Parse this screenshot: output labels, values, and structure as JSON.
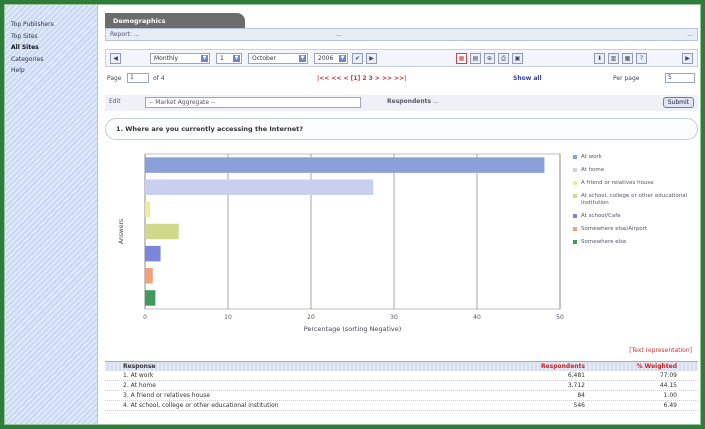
{
  "sidebar": {
    "items": [
      {
        "label": "Top Publishers"
      },
      {
        "label": "Top Sites"
      },
      {
        "label": "All Sites",
        "active": true
      },
      {
        "label": "Categories"
      },
      {
        "label": "Help"
      }
    ]
  },
  "tab": {
    "label": "Demographics"
  },
  "infobar": {
    "left": "Report: ...",
    "middle": "...",
    "right": "..."
  },
  "toolbar": {
    "period": "Monthly",
    "day": "1",
    "month": "October",
    "year": "2006"
  },
  "pager": {
    "page_label": "Page",
    "page_value": "1",
    "of_label": "of 4",
    "nav": "|<< << < [1] 2 3 > >> >>|",
    "show_all": "Show all",
    "per_page_label": "Per page",
    "per_page_value": "5"
  },
  "filter": {
    "label": "Edit",
    "select_value": "-- Market Aggregate --",
    "respondents_label": "Respondents",
    "respondents_value": "...",
    "button": "Submit"
  },
  "question": {
    "text": "1. Where are you currently accessing the Internet?"
  },
  "chart_data": {
    "type": "bar",
    "orientation": "horizontal",
    "title": "",
    "xlabel": "Percentage (sorting Negative)",
    "ylabel": "Answers",
    "xlim": [
      0,
      80
    ],
    "x_ticks": [
      "0",
      "10",
      "20",
      "30",
      "40",
      "50"
    ],
    "series": [
      {
        "name": "At work",
        "value": 77.0,
        "color": "#8aa0d8"
      },
      {
        "name": "At home",
        "value": 44.0,
        "color": "#c9cfee"
      },
      {
        "name": "A friend or relatives house",
        "value": 1.0,
        "color": "#e9ef9c"
      },
      {
        "name": "At school, college or other educational institution",
        "value": 6.5,
        "color": "#cfd98a"
      },
      {
        "name": "At school/Cafe",
        "value": 3.0,
        "color": "#7a86d6"
      },
      {
        "name": "Somewhere else/Airport",
        "value": 1.5,
        "color": "#f2a07c"
      },
      {
        "name": "Somewhere else",
        "value": 2.0,
        "color": "#3f9a5e"
      }
    ],
    "grid": true,
    "legend": "right"
  },
  "table_note": "[Text representation]",
  "table": {
    "headers": {
      "response": "Response",
      "respondents": "Respondents",
      "pct": "% Weighted"
    },
    "rows": [
      {
        "response": "1. At work",
        "respondents": "6,481",
        "pct": "77.09"
      },
      {
        "response": "2. At home",
        "respondents": "3,712",
        "pct": "44.15"
      },
      {
        "response": "3. A friend or relatives house",
        "respondents": "84",
        "pct": "1.00"
      },
      {
        "response": "4. At school, college or other educational institution",
        "respondents": "546",
        "pct": "6.49"
      }
    ]
  },
  "colors": {
    "frame": "#2e7d3a",
    "accent": "#6d86c9",
    "nav_red": "#c33"
  }
}
